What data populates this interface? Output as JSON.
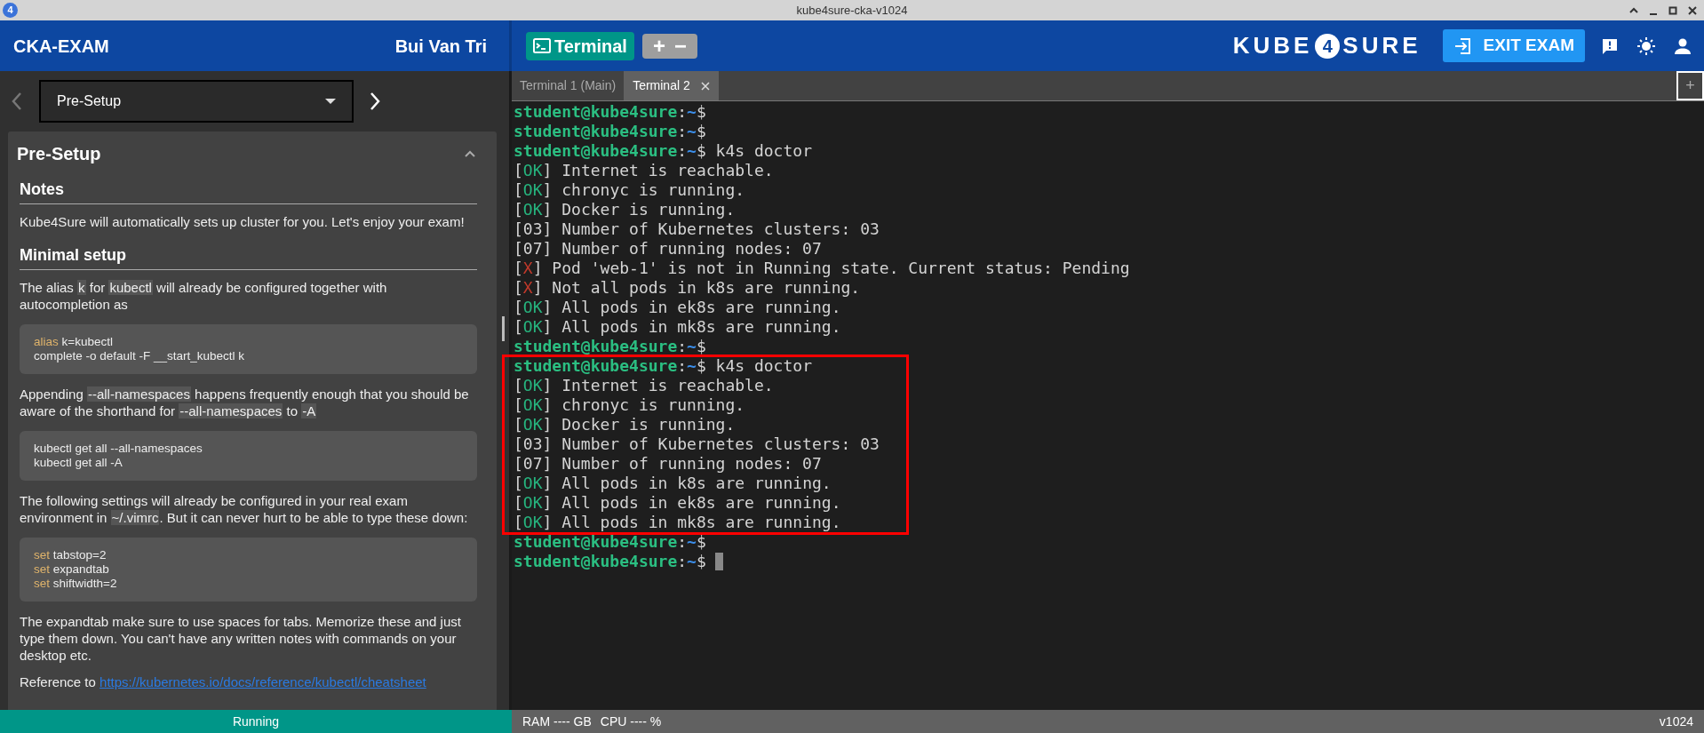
{
  "window": {
    "title": "kube4sure-cka-v1024",
    "app_icon_label": "4"
  },
  "header": {
    "exam_title": "CKA-EXAM",
    "user_name": "Bui Van Tri",
    "terminal_button": "Terminal",
    "zoom_controls": [
      "+",
      "−"
    ],
    "logo": {
      "before": "KUBE",
      "badge": "4",
      "after": "SURE"
    },
    "exit_button": "EXIT EXAM"
  },
  "sidebar": {
    "nav": {
      "prev_disabled": true,
      "next_disabled": false,
      "section": "Pre-Setup"
    },
    "card": {
      "title": "Pre-Setup",
      "expanded": true,
      "blocks": [
        {
          "kind": "heading",
          "text": "Notes"
        },
        {
          "kind": "paragraph",
          "segments": [
            {
              "kind": "text",
              "text": "Kube4Sure will automatically sets up cluster for you. Let's enjoy your exam!"
            }
          ]
        },
        {
          "kind": "heading",
          "text": "Minimal setup"
        },
        {
          "kind": "paragraph",
          "segments": [
            {
              "kind": "text",
              "text": "The alias "
            },
            {
              "kind": "code",
              "text": "k"
            },
            {
              "kind": "text",
              "text": " for "
            },
            {
              "kind": "code",
              "text": "kubectl"
            },
            {
              "kind": "text",
              "text": " will already be configured together with autocompletion as"
            }
          ]
        },
        {
          "kind": "codeblock",
          "lines": [
            [
              {
                "kind": "keyword",
                "text": "alias"
              },
              {
                "kind": "text",
                "text": " k=kubectl"
              }
            ],
            [
              {
                "kind": "text",
                "text": "complete -o default -F __start_kubectl k"
              }
            ]
          ]
        },
        {
          "kind": "paragraph",
          "segments": [
            {
              "kind": "text",
              "text": "Appending "
            },
            {
              "kind": "code",
              "text": "--all-namespaces"
            },
            {
              "kind": "text",
              "text": " happens frequently enough that you should be aware of the shorthand for "
            },
            {
              "kind": "code",
              "text": "--all-namespaces"
            },
            {
              "kind": "text",
              "text": " to "
            },
            {
              "kind": "code",
              "text": "-A"
            }
          ]
        },
        {
          "kind": "codeblock",
          "lines": [
            [
              {
                "kind": "text",
                "text": "kubectl get all --all-namespaces"
              }
            ],
            [
              {
                "kind": "text",
                "text": "kubectl get all -A"
              }
            ]
          ]
        },
        {
          "kind": "paragraph",
          "segments": [
            {
              "kind": "text",
              "text": "The following settings will already be configured in your real exam environment in "
            },
            {
              "kind": "code",
              "text": "~/.vimrc"
            },
            {
              "kind": "text",
              "text": ". But it can never hurt to be able to type these down:"
            }
          ]
        },
        {
          "kind": "codeblock",
          "lines": [
            [
              {
                "kind": "keyword",
                "text": "set"
              },
              {
                "kind": "text",
                "text": " tabstop=2"
              }
            ],
            [
              {
                "kind": "keyword",
                "text": "set"
              },
              {
                "kind": "text",
                "text": " expandtab"
              }
            ],
            [
              {
                "kind": "keyword",
                "text": "set"
              },
              {
                "kind": "text",
                "text": " shiftwidth=2"
              }
            ]
          ]
        },
        {
          "kind": "paragraph",
          "segments": [
            {
              "kind": "text",
              "text": "The expandtab make sure to use spaces for tabs. Memorize these and just type them down. You can't have any written notes with commands on your desktop etc."
            }
          ]
        },
        {
          "kind": "paragraph",
          "segments": [
            {
              "kind": "text",
              "text": "Reference to "
            },
            {
              "kind": "link",
              "text": "https://kubernetes.io/docs/reference/kubectl/cheatsheet"
            }
          ]
        }
      ]
    }
  },
  "terminal": {
    "tabs": [
      {
        "label": "Terminal 1 (Main)",
        "selected": false,
        "closable": false
      },
      {
        "label": "Terminal 2",
        "selected": true,
        "closable": true
      }
    ],
    "new_tab": "+",
    "cursor": true,
    "blocks": [
      {
        "highlighted": false,
        "lines": [
          [
            {
              "kind": "user",
              "text": "student@kube4sure"
            },
            {
              "kind": "plain",
              "text": ":"
            },
            {
              "kind": "path",
              "text": "~"
            },
            {
              "kind": "plain",
              "text": "$"
            }
          ],
          [
            {
              "kind": "user",
              "text": "student@kube4sure"
            },
            {
              "kind": "plain",
              "text": ":"
            },
            {
              "kind": "path",
              "text": "~"
            },
            {
              "kind": "plain",
              "text": "$"
            }
          ],
          [
            {
              "kind": "user",
              "text": "student@kube4sure"
            },
            {
              "kind": "plain",
              "text": ":"
            },
            {
              "kind": "path",
              "text": "~"
            },
            {
              "kind": "plain",
              "text": "$ k4s doctor"
            }
          ],
          [
            {
              "kind": "plain",
              "text": "["
            },
            {
              "kind": "ok",
              "text": "OK"
            },
            {
              "kind": "plain",
              "text": "] Internet is reachable."
            }
          ],
          [
            {
              "kind": "plain",
              "text": "["
            },
            {
              "kind": "ok",
              "text": "OK"
            },
            {
              "kind": "plain",
              "text": "] chronyc is running."
            }
          ],
          [
            {
              "kind": "plain",
              "text": "["
            },
            {
              "kind": "ok",
              "text": "OK"
            },
            {
              "kind": "plain",
              "text": "] Docker is running."
            }
          ],
          [
            {
              "kind": "plain",
              "text": "[03] Number of Kubernetes clusters: 03"
            }
          ],
          [
            {
              "kind": "plain",
              "text": "[07] Number of running nodes: 07"
            }
          ],
          [
            {
              "kind": "plain",
              "text": "["
            },
            {
              "kind": "fail",
              "text": "X"
            },
            {
              "kind": "plain",
              "text": "] Pod 'web-1' is not in Running state. Current status: Pending"
            }
          ],
          [
            {
              "kind": "plain",
              "text": "["
            },
            {
              "kind": "fail",
              "text": "X"
            },
            {
              "kind": "plain",
              "text": "] Not all pods in k8s are running."
            }
          ],
          [
            {
              "kind": "plain",
              "text": "["
            },
            {
              "kind": "ok",
              "text": "OK"
            },
            {
              "kind": "plain",
              "text": "] All pods in ek8s are running."
            }
          ],
          [
            {
              "kind": "plain",
              "text": "["
            },
            {
              "kind": "ok",
              "text": "OK"
            },
            {
              "kind": "plain",
              "text": "] All pods in mk8s are running."
            }
          ],
          [
            {
              "kind": "user",
              "text": "student@kube4sure"
            },
            {
              "kind": "plain",
              "text": ":"
            },
            {
              "kind": "path",
              "text": "~"
            },
            {
              "kind": "plain",
              "text": "$"
            }
          ]
        ]
      },
      {
        "highlighted": true,
        "lines": [
          [
            {
              "kind": "user",
              "text": "student@kube4sure"
            },
            {
              "kind": "plain",
              "text": ":"
            },
            {
              "kind": "path",
              "text": "~"
            },
            {
              "kind": "plain",
              "text": "$ k4s doctor"
            }
          ],
          [
            {
              "kind": "plain",
              "text": "["
            },
            {
              "kind": "ok",
              "text": "OK"
            },
            {
              "kind": "plain",
              "text": "] Internet is reachable."
            }
          ],
          [
            {
              "kind": "plain",
              "text": "["
            },
            {
              "kind": "ok",
              "text": "OK"
            },
            {
              "kind": "plain",
              "text": "] chronyc is running."
            }
          ],
          [
            {
              "kind": "plain",
              "text": "["
            },
            {
              "kind": "ok",
              "text": "OK"
            },
            {
              "kind": "plain",
              "text": "] Docker is running."
            }
          ],
          [
            {
              "kind": "plain",
              "text": "[03] Number of Kubernetes clusters: 03"
            }
          ],
          [
            {
              "kind": "plain",
              "text": "[07] Number of running nodes: 07"
            }
          ],
          [
            {
              "kind": "plain",
              "text": "["
            },
            {
              "kind": "ok",
              "text": "OK"
            },
            {
              "kind": "plain",
              "text": "] All pods in k8s are running."
            }
          ],
          [
            {
              "kind": "plain",
              "text": "["
            },
            {
              "kind": "ok",
              "text": "OK"
            },
            {
              "kind": "plain",
              "text": "] All pods in ek8s are running."
            }
          ],
          [
            {
              "kind": "plain",
              "text": "["
            },
            {
              "kind": "ok",
              "text": "OK"
            },
            {
              "kind": "plain",
              "text": "] All pods in mk8s are running."
            }
          ]
        ]
      },
      {
        "highlighted": false,
        "lines": [
          [
            {
              "kind": "user",
              "text": "student@kube4sure"
            },
            {
              "kind": "plain",
              "text": ":"
            },
            {
              "kind": "path",
              "text": "~"
            },
            {
              "kind": "plain",
              "text": "$"
            }
          ],
          [
            {
              "kind": "user",
              "text": "student@kube4sure"
            },
            {
              "kind": "plain",
              "text": ":"
            },
            {
              "kind": "path",
              "text": "~"
            },
            {
              "kind": "plain",
              "text": "$"
            }
          ]
        ]
      }
    ]
  },
  "status_bar": {
    "state": "Running",
    "ram": "RAM ---- GB",
    "cpu": "CPU ---- %",
    "version": "v1024"
  }
}
